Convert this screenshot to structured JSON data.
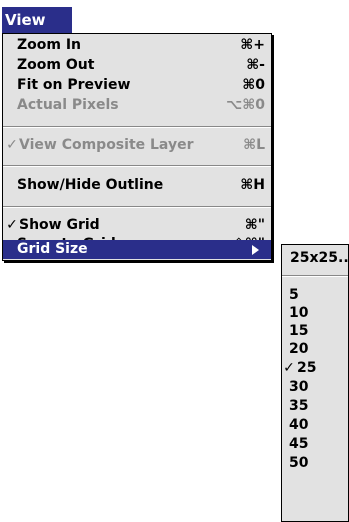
{
  "menu": {
    "title": "View",
    "items": [
      {
        "label": "Zoom In",
        "shortcut": "⌘+",
        "checked": false,
        "disabled": false
      },
      {
        "label": "Zoom Out",
        "shortcut": "⌘-",
        "checked": false,
        "disabled": false
      },
      {
        "label": "Fit on Preview",
        "shortcut": "⌘0",
        "checked": false,
        "disabled": false
      },
      {
        "label": "Actual Pixels",
        "shortcut": "⌥⌘0",
        "checked": false,
        "disabled": true
      },
      {
        "label": "View Composite Layer",
        "shortcut": "⌘L",
        "checked": true,
        "disabled": true
      },
      {
        "label": "Show/Hide Outline",
        "shortcut": "⌘H",
        "checked": false,
        "disabled": false
      },
      {
        "label": "Show Grid",
        "shortcut": "⌘\"",
        "checked": true,
        "disabled": false
      },
      {
        "label": "Snap to Grid",
        "shortcut": "⇧⌘\"",
        "checked": false,
        "disabled": false
      },
      {
        "label": "Grid Size",
        "shortcut": "",
        "checked": false,
        "disabled": false,
        "selected": true,
        "has_submenu": true
      }
    ]
  },
  "submenu": {
    "items": [
      {
        "label": "25x25...",
        "checked": false
      },
      {
        "label": "5",
        "checked": false
      },
      {
        "label": "10",
        "checked": false
      },
      {
        "label": "15",
        "checked": false
      },
      {
        "label": "20",
        "checked": false
      },
      {
        "label": "25",
        "checked": true
      },
      {
        "label": "30",
        "checked": false
      },
      {
        "label": "35",
        "checked": false
      },
      {
        "label": "40",
        "checked": false
      },
      {
        "label": "45",
        "checked": false
      },
      {
        "label": "50",
        "checked": false
      }
    ]
  },
  "check_glyph": "✓",
  "colors": {
    "highlight": "#2a2e8a",
    "menu_bg": "#e2e2e2",
    "disabled_text": "#8a8a8a"
  }
}
